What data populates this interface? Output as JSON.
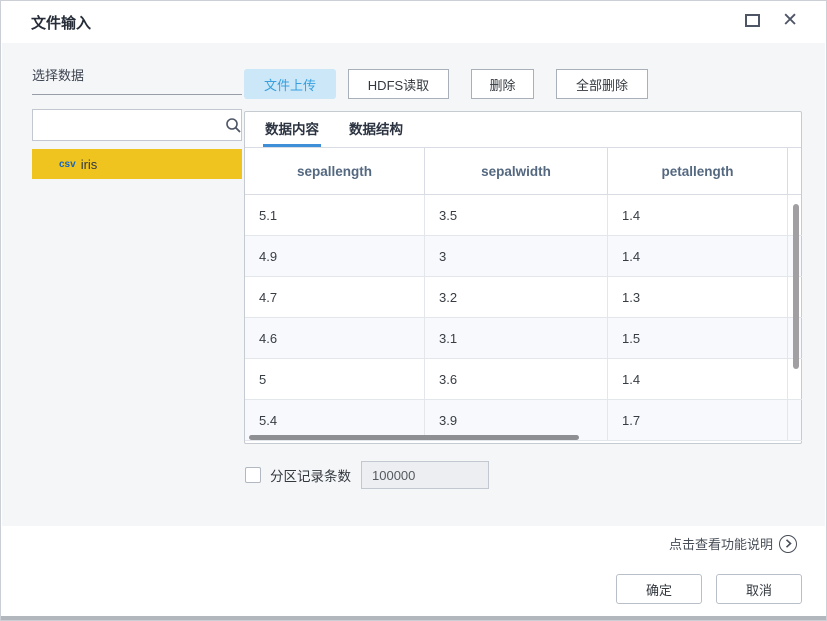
{
  "window": {
    "title": "文件输入",
    "close_glyph": "✕"
  },
  "sidebar": {
    "label": "选择数据",
    "search": {
      "value": "",
      "placeholder": ""
    },
    "items": [
      {
        "prefix": "csv",
        "name": "iris",
        "selected": true
      }
    ]
  },
  "toolbar": {
    "buttons": [
      {
        "label": "文件上传",
        "active": true
      },
      {
        "label": "HDFS读取",
        "active": false
      },
      {
        "label": "删除",
        "active": false
      },
      {
        "label": "全部删除",
        "active": false
      }
    ]
  },
  "tabs": [
    {
      "label": "数据内容",
      "active": true
    },
    {
      "label": "数据结构",
      "active": false
    }
  ],
  "table": {
    "columns": [
      "sepallength",
      "sepalwidth",
      "petallength"
    ],
    "rows": [
      [
        "5.1",
        "3.5",
        "1.4"
      ],
      [
        "4.9",
        "3",
        "1.4"
      ],
      [
        "4.7",
        "3.2",
        "1.3"
      ],
      [
        "4.6",
        "3.1",
        "1.5"
      ],
      [
        "5",
        "3.6",
        "1.4"
      ],
      [
        "5.4",
        "3.9",
        "1.7"
      ]
    ]
  },
  "partition": {
    "checked": false,
    "label": "分区记录条数",
    "value": "100000"
  },
  "footer": {
    "help_link": "点击查看功能说明",
    "ok_label": "确定",
    "cancel_label": "取消"
  },
  "colors": {
    "accent_blue": "#3f8fd8",
    "active_button_bg": "#cbe7f8",
    "active_button_text": "#38a0de",
    "selection_yellow": "#f0c41e",
    "csv_badge_text": "#1565c0",
    "body_bg": "#f5f6f8",
    "header_text": "#546880",
    "row_stripe": "#f7f9fc"
  }
}
